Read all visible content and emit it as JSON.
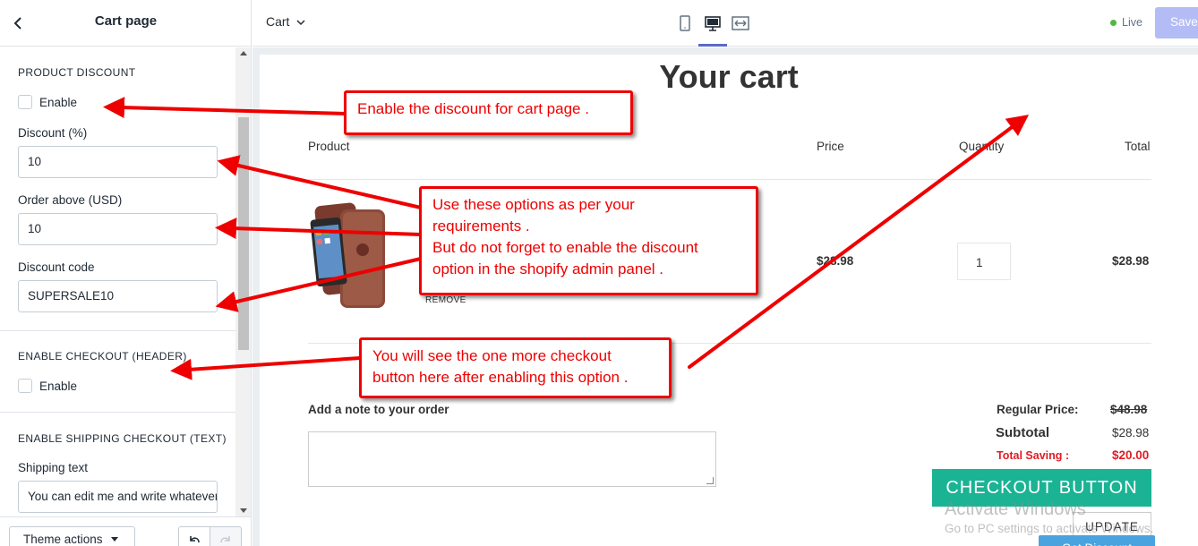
{
  "sidebar": {
    "title": "Cart page",
    "back_icon": "chevron-left-icon",
    "product_discount": {
      "heading": "PRODUCT DISCOUNT",
      "enable_label": "Enable",
      "enable_checked": false,
      "discount_label": "Discount (%)",
      "discount_value": "10",
      "order_above_label": "Order above (USD)",
      "order_above_value": "10",
      "code_label": "Discount code",
      "code_value": "SUPERSALE10"
    },
    "enable_checkout": {
      "heading": "ENABLE CHECKOUT (HEADER)",
      "enable_label": "Enable",
      "enable_checked": false
    },
    "shipping_checkout": {
      "heading": "ENABLE SHIPPING CHECKOUT (TEXT)",
      "shipping_label": "Shipping text",
      "shipping_value": "You can edit me and write whatever"
    },
    "footer": {
      "theme_actions_label": "Theme actions"
    }
  },
  "topbar": {
    "page_select": "Cart",
    "devices": [
      "mobile-icon",
      "desktop-icon",
      "full-width-icon"
    ],
    "active_device": "desktop",
    "status": "Live",
    "save_label": "Save"
  },
  "cart": {
    "title": "Your cart",
    "columns": {
      "product": "Product",
      "price": "Price",
      "quantity": "Quantity",
      "total": "Total"
    },
    "item": {
      "remove_label": "REMOVE",
      "price": "$28.98",
      "quantity": "1",
      "total": "$28.98"
    },
    "note_label": "Add a note to your order",
    "summary": {
      "regular_label": "Regular Price:",
      "regular_value": "$48.98",
      "subtotal_label": "Subtotal",
      "subtotal_value": "$28.98",
      "saving_label": "Total Saving :",
      "saving_value": "$20.00"
    },
    "checkout_button": "CHECKOUT BUTTON",
    "update_button": "UPDATE",
    "get_discount_button": "Get Discount"
  },
  "watermark": {
    "line1": "Activate Windows",
    "line2": "Go to PC settings to activate Windows."
  },
  "annotations": {
    "enable_discount": "Enable the discount for cart page .",
    "options_line1": "Use these options as per your",
    "options_line2": "requirements .",
    "options_line3": "But do not forget to enable the discount",
    "options_line4": "option in the shopify admin panel .",
    "checkout_line1": "You will see the one more checkout",
    "checkout_line2": "button here after enabling this option ."
  },
  "colors": {
    "accent": "#5c6ac4",
    "save_disabled": "#b3bcf5",
    "live_dot": "#50b83c",
    "checkout_button": "#1ab394",
    "saving_red": "#e31b23",
    "annotation_red": "#e00000"
  }
}
